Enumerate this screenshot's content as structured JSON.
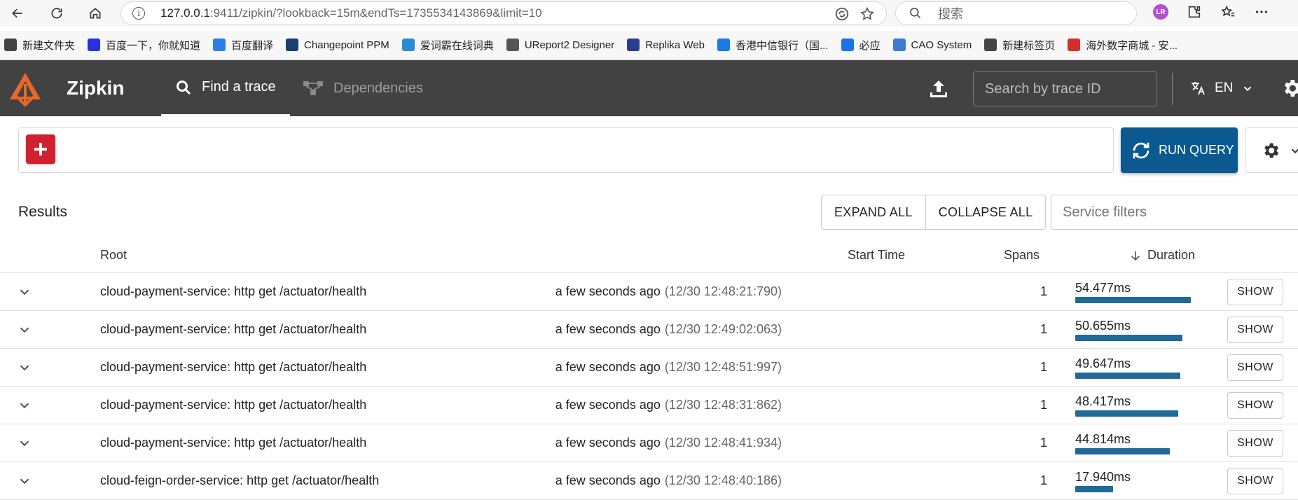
{
  "browser": {
    "url_host": "127.0.0.1",
    "url_path": ":9411/zipkin/?lookback=15m&endTs=1735534143869&limit=10",
    "search_placeholder": "搜索",
    "profile_initials": "LR",
    "bookmarks": [
      {
        "label": "新建文件夹",
        "icon": "folder-icon",
        "color": "#444444"
      },
      {
        "label": "百度一下，你就知道",
        "icon": "baidu-icon",
        "color": "#2932e1"
      },
      {
        "label": "百度翻译",
        "icon": "translate-icon",
        "color": "#2b7de9"
      },
      {
        "label": "Changepoint PPM",
        "icon": "changepoint-icon",
        "color": "#1c3f6e"
      },
      {
        "label": "爱词霸在线词典",
        "icon": "iciba-icon",
        "color": "#2b8cd6"
      },
      {
        "label": "UReport2 Designer",
        "icon": "globe-icon",
        "color": "#555555"
      },
      {
        "label": "Replika Web",
        "icon": "replika-icon",
        "color": "#2a3e8f"
      },
      {
        "label": "香港中信银行（国...",
        "icon": "citic-icon",
        "color": "#1a7be0"
      },
      {
        "label": "必应",
        "icon": "bing-search-icon",
        "color": "#1a73e8"
      },
      {
        "label": "CAO System",
        "icon": "als-icon",
        "color": "#3b7bd6"
      },
      {
        "label": "新建标签页",
        "icon": "refresh-icon",
        "color": "#444444"
      },
      {
        "label": "海外数字商城 - 安...",
        "icon": "store-icon",
        "color": "#d32f2f"
      }
    ]
  },
  "header": {
    "brand": "Zipkin",
    "tab_find": "Find a trace",
    "tab_deps": "Dependencies",
    "trace_id_placeholder": "Search by trace ID",
    "language": "EN"
  },
  "query": {
    "run_label": "RUN QUERY"
  },
  "results": {
    "title": "Results",
    "expand_all": "EXPAND ALL",
    "collapse_all": "COLLAPSE ALL",
    "service_filters_placeholder": "Service filters",
    "columns": {
      "root": "Root",
      "start_time": "Start Time",
      "spans": "Spans",
      "duration": "Duration"
    },
    "show_label": "SHOW",
    "rows": [
      {
        "root": "cloud-payment-service: http get /actuator/health",
        "ago": "a few seconds ago",
        "timestamp": "(12/30 12:48:21:790)",
        "spans": "1",
        "duration": "54.477ms",
        "duration_ratio": 1.0
      },
      {
        "root": "cloud-payment-service: http get /actuator/health",
        "ago": "a few seconds ago",
        "timestamp": "(12/30 12:49:02:063)",
        "spans": "1",
        "duration": "50.655ms",
        "duration_ratio": 0.93
      },
      {
        "root": "cloud-payment-service: http get /actuator/health",
        "ago": "a few seconds ago",
        "timestamp": "(12/30 12:48:51:997)",
        "spans": "1",
        "duration": "49.647ms",
        "duration_ratio": 0.91
      },
      {
        "root": "cloud-payment-service: http get /actuator/health",
        "ago": "a few seconds ago",
        "timestamp": "(12/30 12:48:31:862)",
        "spans": "1",
        "duration": "48.417ms",
        "duration_ratio": 0.89
      },
      {
        "root": "cloud-payment-service: http get /actuator/health",
        "ago": "a few seconds ago",
        "timestamp": "(12/30 12:48:41:934)",
        "spans": "1",
        "duration": "44.814ms",
        "duration_ratio": 0.82
      },
      {
        "root": "cloud-feign-order-service: http get /actuator/health",
        "ago": "a few seconds ago",
        "timestamp": "(12/30 12:48:40:186)",
        "spans": "1",
        "duration": "17.940ms",
        "duration_ratio": 0.33
      }
    ]
  },
  "colors": {
    "header_bg": "#424242",
    "accent_blue": "#0a5a91",
    "add_red": "#d1202f",
    "duration_bar": "#1f6a96",
    "logo_orange": "#e8682a"
  }
}
